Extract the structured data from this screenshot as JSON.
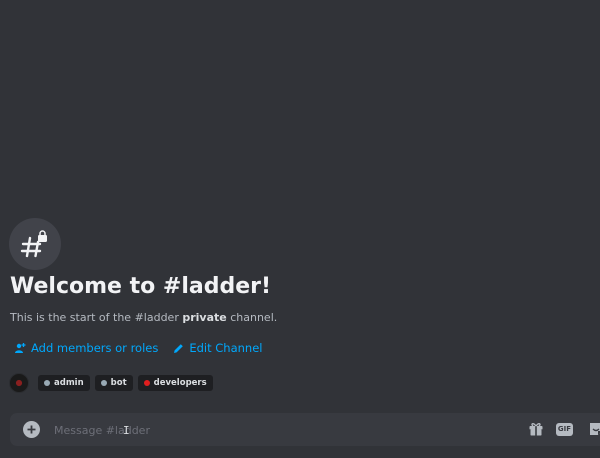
{
  "welcome": {
    "title": "Welcome to #ladder!",
    "subtitle_prefix": "This is the start of the #ladder ",
    "subtitle_bold": "private",
    "subtitle_suffix": " channel."
  },
  "actions": {
    "add_members": "Add members or roles",
    "edit_channel": "Edit Channel"
  },
  "roles": [
    {
      "name": "admin",
      "color": "#99aab5"
    },
    {
      "name": "bot",
      "color": "#99aab5"
    },
    {
      "name": "developers",
      "color": "#e01e1e"
    }
  ],
  "composer": {
    "placeholder": "Message #ladder"
  },
  "colors": {
    "background": "#313338",
    "accent_link": "#00a8fc",
    "composer_bg": "#383a40"
  },
  "icons": {
    "channel": "private-hashtag-lock-icon",
    "add_members": "add-member-icon",
    "edit": "pencil-icon",
    "attach": "plus-circle-icon",
    "gift": "gift-icon",
    "gif": "gif-icon",
    "sticker": "sticker-icon"
  }
}
